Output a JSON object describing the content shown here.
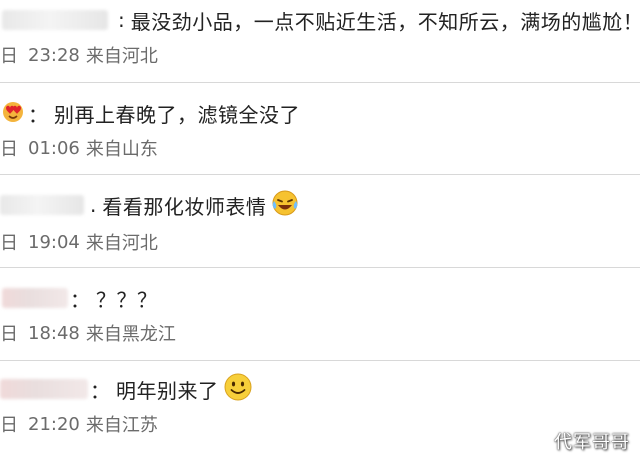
{
  "comments": [
    {
      "separator": ":",
      "text": "最没劲小品，一点不贴近生活，不知所云，满场的尴尬！",
      "day": "日",
      "time": "23:28",
      "location": "来自河北"
    },
    {
      "separator": "：",
      "text": "别再上春晚了，滤镜全没了",
      "day": "日",
      "time": "01:06",
      "location": "来自山东"
    },
    {
      "separator": ".",
      "text": "看看那化妆师表情",
      "day": "日",
      "time": "19:04",
      "location": "来自河北"
    },
    {
      "separator": "：",
      "text": "？？？",
      "day": "日",
      "time": "18:48",
      "location": "来自黑龙江"
    },
    {
      "separator": "：",
      "text": "明年别来了",
      "day": "日",
      "time": "21:20",
      "location": "来自江苏"
    }
  ],
  "icons": {
    "avatar_badge": "red-heart-face-icon",
    "laugh_cry": "laughing-crying-emoji-icon",
    "smile": "smiling-face-emoji-icon"
  },
  "watermark": "代军哥哥"
}
